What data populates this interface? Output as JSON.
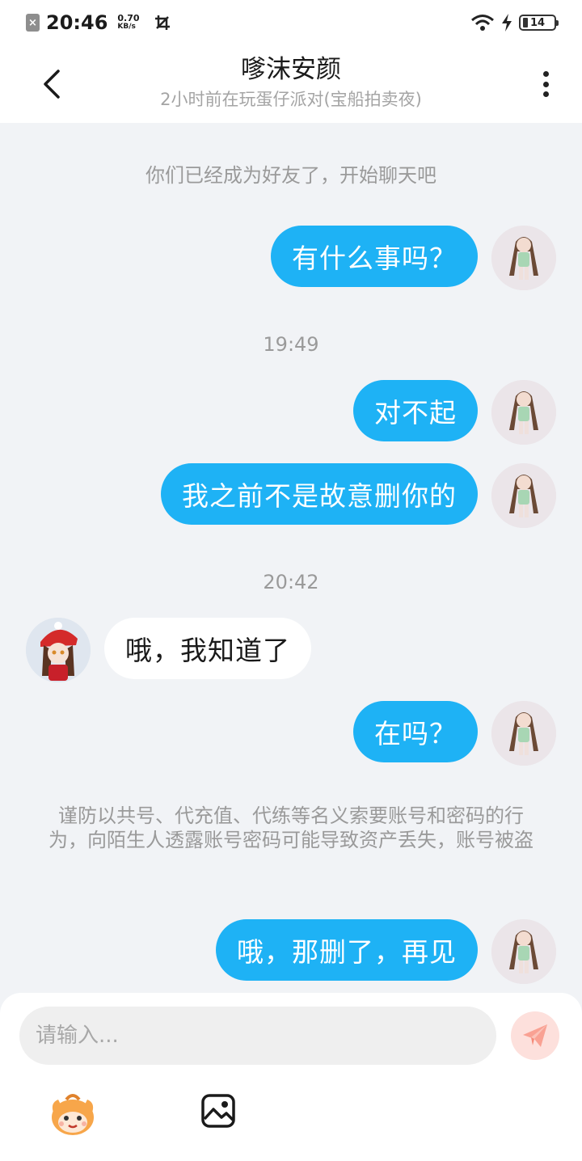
{
  "status_bar": {
    "time": "20:46",
    "speed_value": "0.70",
    "speed_unit": "KB/s",
    "battery": "14"
  },
  "header": {
    "title": "嗲沫安颜",
    "subtitle": "2小时前在玩蛋仔派对(宝船拍卖夜)"
  },
  "chat": {
    "system_friend": "你们已经成为好友了，开始聊天吧",
    "time_1": "19:49",
    "time_2": "20:42",
    "warning": "谨防以共号、代充值、代练等名义索要账号和密码的行为，向陌生人透露账号密码可能导致资产丢失，账号被盗",
    "messages": [
      {
        "from": "me",
        "text": "有什么事吗？"
      },
      {
        "from": "me",
        "text": "对不起"
      },
      {
        "from": "me",
        "text": "我之前不是故意删你的"
      },
      {
        "from": "them",
        "text": "哦，我知道了"
      },
      {
        "from": "me",
        "text": "在吗？"
      },
      {
        "from": "me",
        "text": "哦，那删了，再见"
      }
    ]
  },
  "footer": {
    "input_placeholder": "请输入...",
    "input_value": ""
  },
  "colors": {
    "bubble_me": "#1eb2f5",
    "bubble_them": "#ffffff",
    "background": "#f1f3f6",
    "send_button": "#fde0dc",
    "send_icon": "#f9a193"
  },
  "icons": {
    "back": "back-arrow-icon",
    "more": "more-vertical-icon",
    "send": "paper-plane-icon",
    "emoji": "eggy-emoji-icon",
    "image": "image-icon"
  }
}
